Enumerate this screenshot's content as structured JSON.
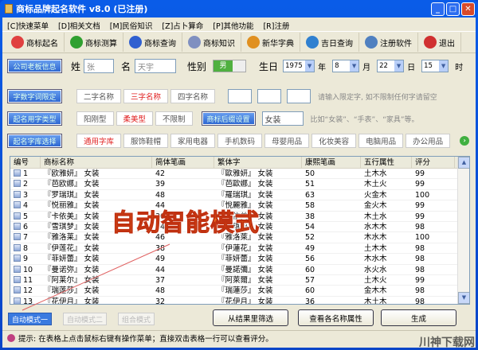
{
  "title": "商标品牌起名软件 v8.0 (已注册)",
  "menu": [
    "[C]快速菜单",
    "[D]相关文档",
    "[M]民俗知识",
    "[Z]占卜算命",
    "[P]其他功能",
    "[R]注册"
  ],
  "toolbar": [
    {
      "label": "商标起名",
      "icon": "heart-icon",
      "color": "#e04040"
    },
    {
      "label": "商标测算",
      "icon": "arrow-right-icon",
      "color": "#30a030"
    },
    {
      "label": "商标查询",
      "icon": "help-icon",
      "color": "#3060d0"
    },
    {
      "label": "商标知识",
      "icon": "document-icon",
      "color": "#8090c0"
    },
    {
      "label": "新华字典",
      "icon": "windows-icon",
      "color": "#e09020"
    },
    {
      "label": "吉日查询",
      "icon": "globe-icon",
      "color": "#3080d0"
    },
    {
      "label": "注册软件",
      "icon": "computer-icon",
      "color": "#5080c0"
    },
    {
      "label": "退出",
      "icon": "close-icon",
      "color": "#d03030"
    }
  ],
  "info": {
    "button": "公司老板信息",
    "surname_label": "姓",
    "surname": "张",
    "name_label": "名",
    "name": "天宇",
    "gender_label": "性别",
    "gender": "男",
    "birth_label": "生日",
    "year": "1975",
    "year_unit": "年",
    "month": "8",
    "month_unit": "月",
    "day": "22",
    "day_unit": "日",
    "hour": "15",
    "hour_unit": "时"
  },
  "length": {
    "button": "字数字词限定",
    "options": [
      "二字名称",
      "三字名称",
      "四字名称"
    ],
    "selected": 1,
    "hint": "请输入限定字, 如不限制任何字请留空"
  },
  "style": {
    "button": "起名用字类型",
    "options": [
      "阳刚型",
      "柔美型",
      "不限制"
    ],
    "selected": 1,
    "suffix_button": "商标后缀设置",
    "suffix": "女装",
    "hint": "比如“女装”、“手表”、“家具”等。"
  },
  "library": {
    "button": "起名字库选择",
    "options": [
      "通用字库",
      "服饰鞋帽",
      "家用电器",
      "手机数码",
      "母婴用品",
      "化妆美容",
      "电脑用品",
      "办公用品"
    ],
    "selected": 0
  },
  "table": {
    "headers": [
      "编号",
      "商标名称",
      "简体笔画",
      "繁体字",
      "康熙笔画",
      "五行属性",
      "评分"
    ],
    "rows": [
      [
        "1",
        "『欧雅妍』 女装",
        "42",
        "『歐雅妍』 女装",
        "50",
        "土木水",
        "99"
      ],
      [
        "2",
        "『芭欧娜』 女装",
        "39",
        "『芭歐娜』 女装",
        "51",
        "木土火",
        "99"
      ],
      [
        "3",
        "『罗瑞琪』 女装",
        "48",
        "『羅瑞琪』 女装",
        "63",
        "火金木",
        "100"
      ],
      [
        "4",
        "『悦丽雅』 女装",
        "44",
        "『悅麗雅』 女装",
        "58",
        "金火木",
        "99"
      ],
      [
        "5",
        "『卡依美』 女装",
        "30",
        "『卡依美』 女装",
        "38",
        "木土水",
        "99"
      ],
      [
        "6",
        "『雪琪梦』 女装",
        "44",
        "『雪琪夢』 女装",
        "54",
        "水木木",
        "98"
      ],
      [
        "7",
        "『雅洛莱』 女装",
        "46",
        "『雅洛萊』 女装",
        "52",
        "木水木",
        "100"
      ],
      [
        "8",
        "『伊莲花』 女装",
        "38",
        "『伊蓮花』 女装",
        "49",
        "土木木",
        "98"
      ],
      [
        "9",
        "『菲妍蕾』 女装",
        "49",
        "『菲妍蕾』 女装",
        "56",
        "木水木",
        "98"
      ],
      [
        "10",
        "『曼诺弥』 女装",
        "44",
        "『曼諾彌』 女装",
        "60",
        "水火水",
        "98"
      ],
      [
        "11",
        "『阿莱尔』 女装",
        "37",
        "『阿萊爾』 女装",
        "57",
        "土木火",
        "99"
      ],
      [
        "12",
        "『瑞莲莎』 女装",
        "48",
        "『瑞蓮莎』 女装",
        "60",
        "金木木",
        "98"
      ],
      [
        "13",
        "『花伊月』 女装",
        "32",
        "『花伊月』 女装",
        "36",
        "木土木",
        "98"
      ]
    ]
  },
  "modes": [
    "自动模式一",
    "自动模式二",
    "组合模式"
  ],
  "actions": [
    "从结果里筛选",
    "查看各名称属性",
    "生成"
  ],
  "status": "提示: 在表格上点击鼠标右键有操作菜单；直接双击表格一行可以查看评分。",
  "overlay": "自动智能模式",
  "watermark": "川神下载网"
}
